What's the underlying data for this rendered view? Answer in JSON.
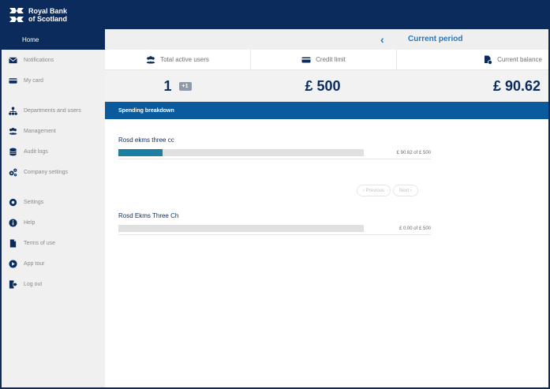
{
  "brand": {
    "line1": "Royal Bank",
    "line2": "of Scotland"
  },
  "sidebar": {
    "home": "Home",
    "items": [
      {
        "label": "Notifications",
        "icon": "mail-icon"
      },
      {
        "label": "My card",
        "icon": "card-icon"
      },
      {
        "label": "Departments and users",
        "icon": "org-chart-icon"
      },
      {
        "label": "Management",
        "icon": "users-icon"
      },
      {
        "label": "Audit logs",
        "icon": "database-icon"
      },
      {
        "label": "Company settings",
        "icon": "gears-icon"
      },
      {
        "label": "Settings",
        "icon": "cog-icon"
      },
      {
        "label": "Help",
        "icon": "info-icon"
      },
      {
        "label": "Terms of use",
        "icon": "document-icon"
      },
      {
        "label": "App tour",
        "icon": "play-icon"
      },
      {
        "label": "Log out",
        "icon": "logout-icon"
      }
    ]
  },
  "period": {
    "title": "Current period",
    "arrow": "‹"
  },
  "stats": {
    "headers": [
      "Total active users",
      "Credit limit",
      "Current balance"
    ],
    "active_users": "1",
    "active_users_badge": "+1",
    "credit_limit": "£ 500",
    "current_balance": "£ 90.62"
  },
  "spending": {
    "title": "Spending breakdown",
    "rows": [
      {
        "name": "Rosd ekms three cc",
        "amount": "£ 90.62 of £ 500",
        "fraction": 0.1812
      },
      {
        "name": "Rosd Ekms Three Ch",
        "amount": "£ 0.00 of £ 500",
        "fraction": 0
      }
    ],
    "pager": {
      "previous": "‹ Previous",
      "next": "Next ›"
    }
  },
  "colors": {
    "navy": "#0a2b5c",
    "accent": "#1e78c8",
    "section": "#0a5a9e",
    "bar": "#1a7fa3"
  }
}
